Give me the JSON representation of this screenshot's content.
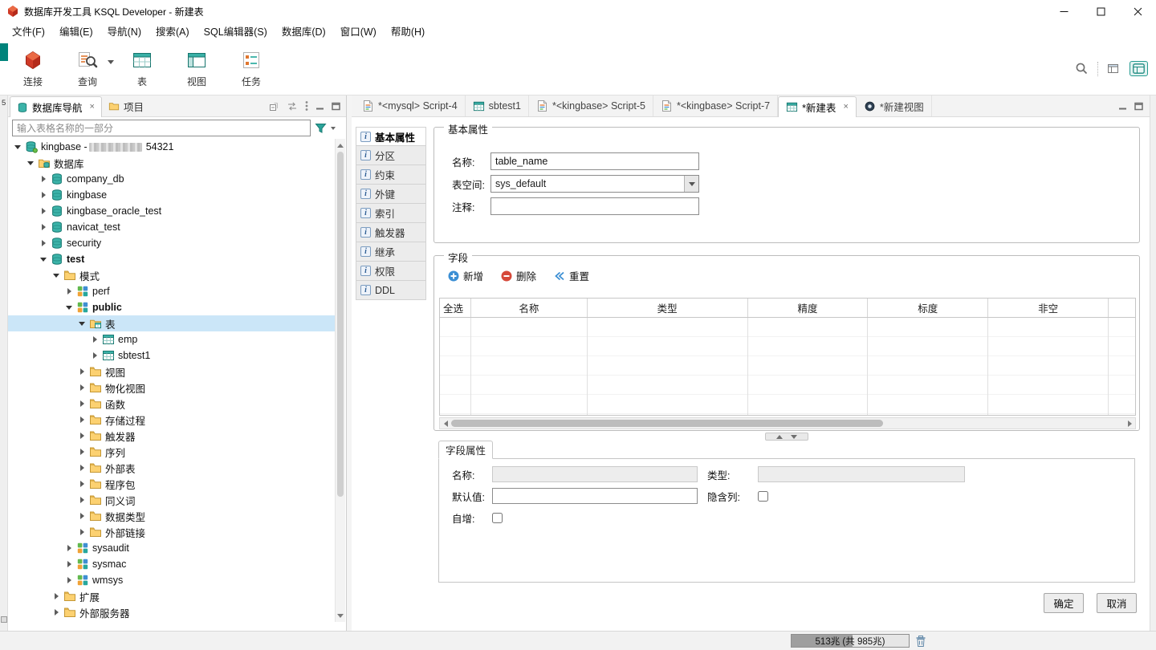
{
  "window": {
    "title": "数据库开发工具 KSQL Developer - 新建表"
  },
  "menu": {
    "items": [
      "文件(F)",
      "编辑(E)",
      "导航(N)",
      "搜索(A)",
      "SQL编辑器(S)",
      "数据库(D)",
      "窗口(W)",
      "帮助(H)"
    ]
  },
  "toolbar": {
    "buttons": [
      {
        "label": "连接",
        "icon": "connect-icon",
        "dropdown": false
      },
      {
        "label": "查询",
        "icon": "query-icon",
        "dropdown": true
      },
      {
        "label": "表",
        "icon": "table-big-icon",
        "dropdown": false
      },
      {
        "label": "视图",
        "icon": "view-big-icon",
        "dropdown": false
      },
      {
        "label": "任务",
        "icon": "tasks-icon",
        "dropdown": false
      }
    ]
  },
  "left_rail": {
    "top_label": "5"
  },
  "navigator": {
    "tabs": [
      {
        "label": "数据库导航",
        "icon": "db-navigator-icon",
        "active": true,
        "closable": true
      },
      {
        "label": "项目",
        "icon": "project-icon",
        "active": false,
        "closable": false
      }
    ],
    "filter_placeholder": "输入表格名称的一部分",
    "tree": [
      {
        "label": "kingbase - ",
        "masked_suffix": "54321",
        "level": 0,
        "icon": "server",
        "state": "expanded"
      },
      {
        "label": "数据库",
        "level": 1,
        "icon": "folder-db",
        "state": "expanded"
      },
      {
        "label": "company_db",
        "level": 2,
        "icon": "database",
        "state": "collapsed"
      },
      {
        "label": "kingbase",
        "level": 2,
        "icon": "database",
        "state": "collapsed"
      },
      {
        "label": "kingbase_oracle_test",
        "level": 2,
        "icon": "database",
        "state": "collapsed"
      },
      {
        "label": "navicat_test",
        "level": 2,
        "icon": "database",
        "state": "collapsed"
      },
      {
        "label": "security",
        "level": 2,
        "icon": "database",
        "state": "collapsed"
      },
      {
        "label": "test",
        "level": 2,
        "icon": "database",
        "state": "expanded",
        "bold": true
      },
      {
        "label": "模式",
        "level": 3,
        "icon": "folder",
        "state": "expanded"
      },
      {
        "label": "perf",
        "level": 4,
        "icon": "schema",
        "state": "collapsed"
      },
      {
        "label": "public",
        "level": 4,
        "icon": "schema",
        "state": "expanded",
        "bold": true
      },
      {
        "label": "表",
        "level": 5,
        "icon": "folder-table",
        "state": "expanded",
        "selected": true
      },
      {
        "label": "emp",
        "level": 6,
        "icon": "table",
        "state": "collapsed"
      },
      {
        "label": "sbtest1",
        "level": 6,
        "icon": "table",
        "state": "collapsed"
      },
      {
        "label": "视图",
        "level": 5,
        "icon": "folder",
        "state": "collapsed"
      },
      {
        "label": "物化视图",
        "level": 5,
        "icon": "folder",
        "state": "collapsed"
      },
      {
        "label": "函数",
        "level": 5,
        "icon": "folder",
        "state": "collapsed"
      },
      {
        "label": "存储过程",
        "level": 5,
        "icon": "folder",
        "state": "collapsed"
      },
      {
        "label": "触发器",
        "level": 5,
        "icon": "folder",
        "state": "collapsed"
      },
      {
        "label": "序列",
        "level": 5,
        "icon": "folder",
        "state": "collapsed"
      },
      {
        "label": "外部表",
        "level": 5,
        "icon": "folder",
        "state": "collapsed"
      },
      {
        "label": "程序包",
        "level": 5,
        "icon": "folder",
        "state": "collapsed"
      },
      {
        "label": "同义词",
        "level": 5,
        "icon": "folder",
        "state": "collapsed"
      },
      {
        "label": "数据类型",
        "level": 5,
        "icon": "folder",
        "state": "collapsed"
      },
      {
        "label": "外部链接",
        "level": 5,
        "icon": "folder",
        "state": "collapsed"
      },
      {
        "label": "sysaudit",
        "level": 4,
        "icon": "schema",
        "state": "collapsed"
      },
      {
        "label": "sysmac",
        "level": 4,
        "icon": "schema",
        "state": "collapsed"
      },
      {
        "label": "wmsys",
        "level": 4,
        "icon": "schema",
        "state": "collapsed"
      },
      {
        "label": "扩展",
        "level": 3,
        "icon": "folder",
        "state": "collapsed"
      },
      {
        "label": "外部服务器",
        "level": 3,
        "icon": "folder",
        "state": "collapsed"
      },
      {
        "label": "",
        "level": 2,
        "icon": "folder",
        "state": "collapsed",
        "partial": true
      }
    ]
  },
  "editor": {
    "tabs": [
      {
        "label": "*<mysql> Script-4",
        "icon": "sql-script-icon",
        "active": false,
        "closable": false
      },
      {
        "label": "sbtest1",
        "icon": "table-icon",
        "active": false,
        "closable": false
      },
      {
        "label": "*<kingbase> Script-5",
        "icon": "sql-script-icon",
        "active": false,
        "closable": false
      },
      {
        "label": "*<kingbase> Script-7",
        "icon": "sql-script-icon",
        "active": false,
        "closable": false
      },
      {
        "label": "*新建表",
        "icon": "table-icon",
        "active": true,
        "closable": true
      },
      {
        "label": "*新建视图",
        "icon": "view-icon",
        "active": false,
        "closable": false
      }
    ],
    "categories": [
      {
        "label": "基本属性",
        "active": true
      },
      {
        "label": "分区",
        "active": false
      },
      {
        "label": "约束",
        "active": false
      },
      {
        "label": "外键",
        "active": false
      },
      {
        "label": "索引",
        "active": false
      },
      {
        "label": "触发器",
        "active": false
      },
      {
        "label": "继承",
        "active": false
      },
      {
        "label": "权限",
        "active": false
      },
      {
        "label": "DDL",
        "active": false
      }
    ],
    "basic_section": {
      "legend": "基本属性",
      "name_label": "名称:",
      "name_value": "table_name",
      "tablespace_label": "表空间:",
      "tablespace_value": "sys_default",
      "comment_label": "注释:",
      "comment_value": ""
    },
    "fields_section": {
      "legend": "字段",
      "add_label": "新增",
      "delete_label": "删除",
      "reset_label": "重置",
      "columns": [
        "全选",
        "名称",
        "类型",
        "精度",
        "标度",
        "非空"
      ]
    },
    "field_props": {
      "tab_label": "字段属性",
      "name_label": "名称:",
      "type_label": "类型:",
      "default_label": "默认值:",
      "hidden_label": "隐含列:",
      "autoinc_label": "自增:",
      "name_value": "",
      "type_value": "",
      "default_value": ""
    },
    "ok_label": "确定",
    "cancel_label": "取消"
  },
  "statusbar": {
    "memory_text": "513兆 (共 985兆)",
    "memory_used_percent": 52
  }
}
